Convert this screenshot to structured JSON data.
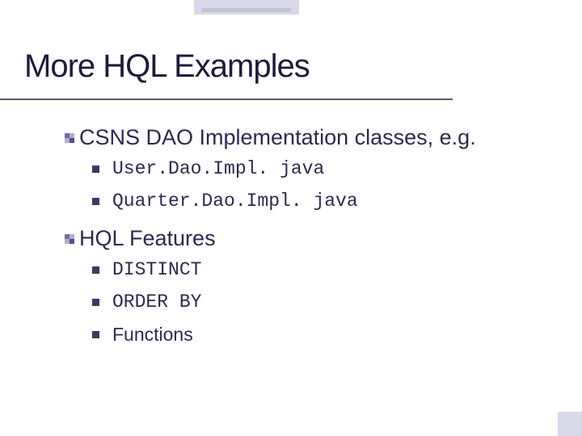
{
  "title": "More HQL Examples",
  "items": [
    {
      "text": "CSNS DAO Implementation classes, e.g.",
      "sub": [
        "User.Dao.Impl. java",
        "Quarter.Dao.Impl. java"
      ]
    },
    {
      "text": "HQL Features",
      "sub": [
        "DISTINCT",
        "ORDER BY",
        "Functions"
      ]
    }
  ]
}
